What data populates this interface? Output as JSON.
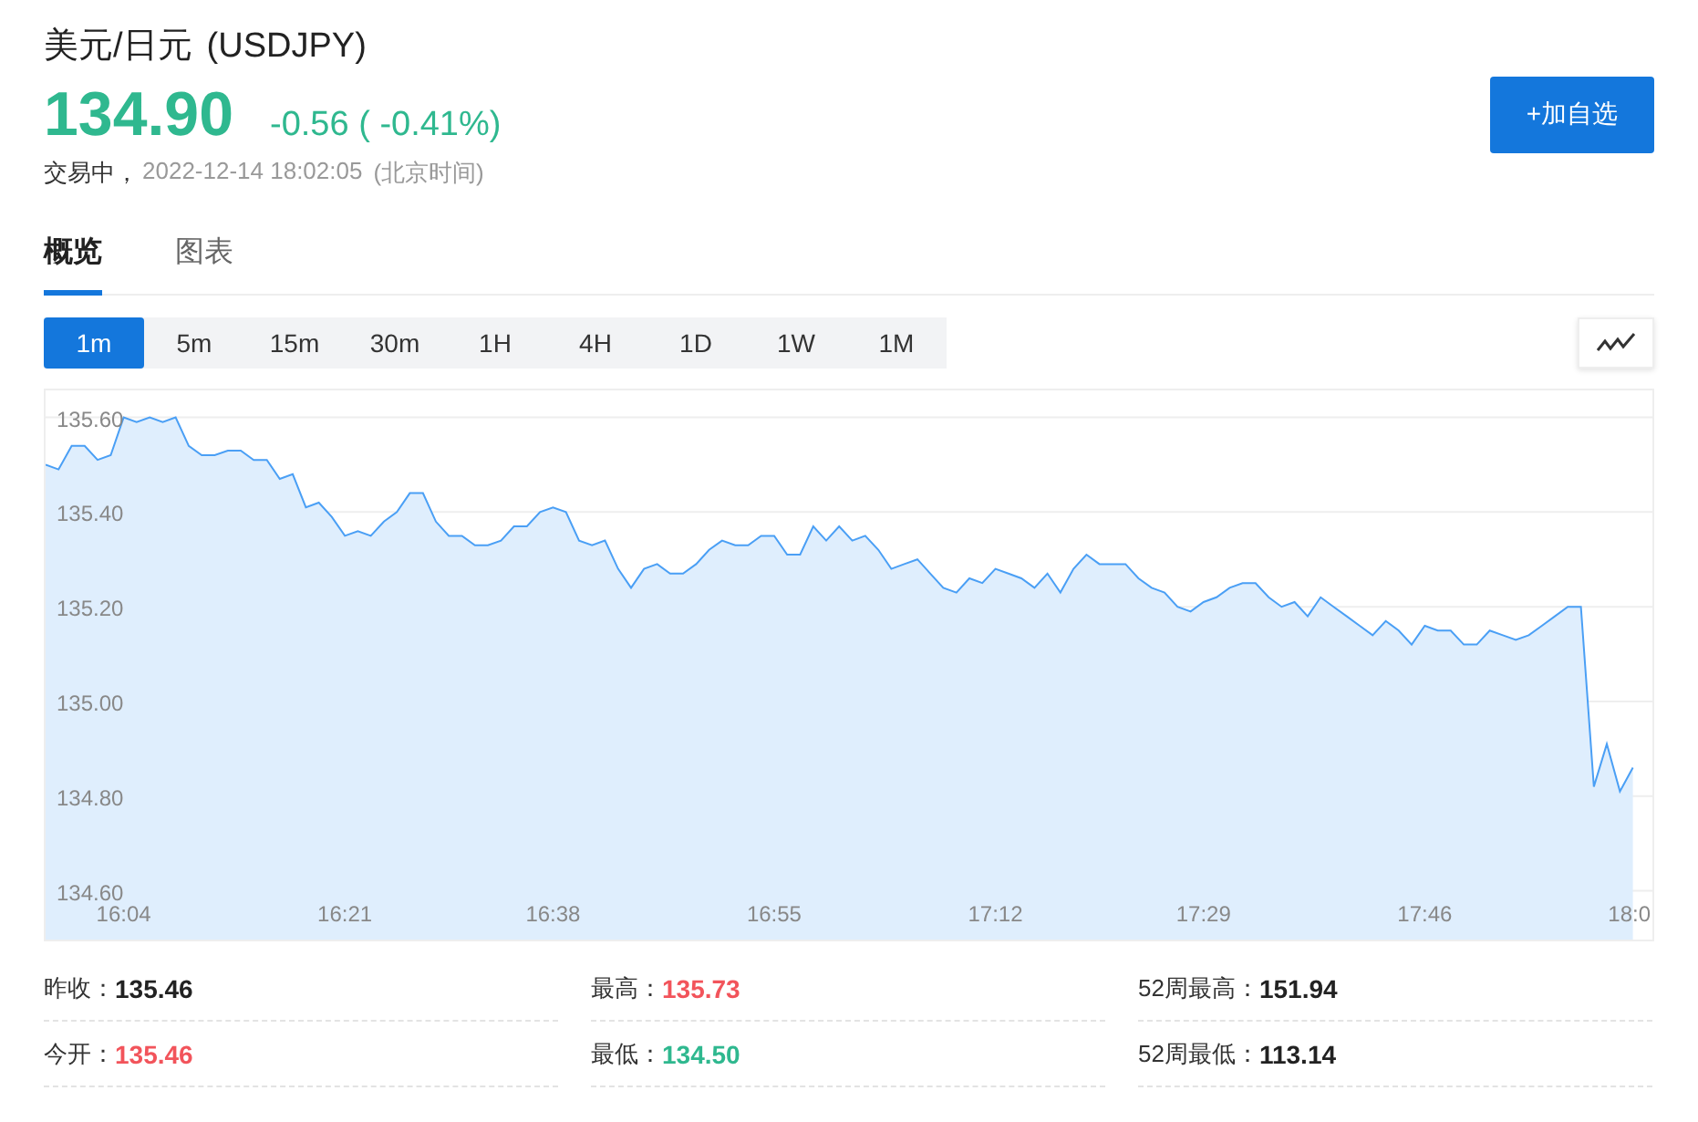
{
  "header": {
    "title": "美元/日元",
    "symbol": "(USDJPY)",
    "price": "134.90",
    "change": "-0.56 ( -0.41%)",
    "status": "交易中，",
    "timestamp": "2022-12-14 18:02:05",
    "timezone": "(北京时间)",
    "add_button": "+加自选"
  },
  "tabs": [
    {
      "label": "概览",
      "selected": true
    },
    {
      "label": "图表",
      "selected": false
    }
  ],
  "ranges": [
    {
      "label": "1m",
      "selected": true
    },
    {
      "label": "5m",
      "selected": false
    },
    {
      "label": "15m",
      "selected": false
    },
    {
      "label": "30m",
      "selected": false
    },
    {
      "label": "1H",
      "selected": false
    },
    {
      "label": "4H",
      "selected": false
    },
    {
      "label": "1D",
      "selected": false
    },
    {
      "label": "1W",
      "selected": false
    },
    {
      "label": "1M",
      "selected": false
    }
  ],
  "chart_data": {
    "type": "area",
    "grid": true,
    "ylim": [
      134.497,
      135.657
    ],
    "yticks": [
      {
        "value": 134.6,
        "label": "134.60"
      },
      {
        "value": 134.8,
        "label": "134.80"
      },
      {
        "value": 135.0,
        "label": "135.00"
      },
      {
        "value": 135.2,
        "label": "135.20"
      },
      {
        "value": 135.4,
        "label": "135.40"
      },
      {
        "value": 135.6,
        "label": "135.60"
      }
    ],
    "categories": [
      null,
      null,
      null,
      null,
      null,
      null,
      "16:04",
      null,
      null,
      null,
      null,
      null,
      null,
      null,
      null,
      null,
      null,
      null,
      null,
      null,
      null,
      null,
      null,
      "16:21",
      null,
      null,
      null,
      null,
      null,
      null,
      null,
      null,
      null,
      null,
      null,
      null,
      null,
      null,
      null,
      "16:38",
      null,
      null,
      null,
      null,
      null,
      null,
      null,
      null,
      null,
      null,
      null,
      null,
      null,
      null,
      null,
      null,
      "16:55",
      null,
      null,
      null,
      null,
      null,
      null,
      null,
      null,
      null,
      null,
      null,
      null,
      null,
      null,
      null,
      null,
      "17:12",
      null,
      null,
      null,
      null,
      null,
      null,
      null,
      null,
      null,
      null,
      null,
      null,
      null,
      null,
      null,
      "17:29",
      null,
      null,
      null,
      null,
      null,
      null,
      null,
      null,
      null,
      null,
      null,
      null,
      null,
      null,
      null,
      null,
      "17:46",
      null,
      null,
      null,
      null,
      null,
      null,
      null,
      null,
      null,
      null,
      null,
      null,
      null,
      null,
      null,
      "18:0"
    ],
    "series": [
      {
        "color": "#4a9ff5",
        "values": [
          135.5,
          135.49,
          135.54,
          135.54,
          135.51,
          135.52,
          135.6,
          135.59,
          135.6,
          135.59,
          135.6,
          135.54,
          135.52,
          135.52,
          135.53,
          135.53,
          135.51,
          135.51,
          135.47,
          135.48,
          135.41,
          135.42,
          135.39,
          135.35,
          135.36,
          135.35,
          135.38,
          135.4,
          135.44,
          135.44,
          135.38,
          135.35,
          135.35,
          135.33,
          135.33,
          135.34,
          135.37,
          135.37,
          135.4,
          135.41,
          135.4,
          135.34,
          135.33,
          135.34,
          135.28,
          135.24,
          135.28,
          135.29,
          135.27,
          135.27,
          135.29,
          135.32,
          135.34,
          135.33,
          135.33,
          135.35,
          135.35,
          135.31,
          135.31,
          135.37,
          135.34,
          135.37,
          135.34,
          135.35,
          135.32,
          135.28,
          135.29,
          135.3,
          135.27,
          135.24,
          135.23,
          135.26,
          135.25,
          135.28,
          135.27,
          135.26,
          135.24,
          135.27,
          135.23,
          135.28,
          135.31,
          135.29,
          135.29,
          135.29,
          135.26,
          135.24,
          135.23,
          135.2,
          135.19,
          135.21,
          135.22,
          135.24,
          135.25,
          135.25,
          135.22,
          135.2,
          135.21,
          135.18,
          135.22,
          135.2,
          135.18,
          135.16,
          135.14,
          135.17,
          135.15,
          135.12,
          135.16,
          135.15,
          135.15,
          135.12,
          135.12,
          135.15,
          135.14,
          135.13,
          135.14,
          135.16,
          135.18,
          135.2,
          135.2,
          134.82,
          134.91,
          134.81,
          134.86
        ]
      }
    ]
  },
  "stats": [
    {
      "label": "昨收：",
      "value": "135.46",
      "color": "#222222"
    },
    {
      "label": "最高：",
      "value": "135.73",
      "color": "#f2545b"
    },
    {
      "label": "52周最高：",
      "value": "151.94",
      "color": "#222222"
    },
    {
      "label": "今开：",
      "value": "135.46",
      "color": "#f2545b"
    },
    {
      "label": "最低：",
      "value": "134.50",
      "color": "#2fb88f"
    },
    {
      "label": "52周最低：",
      "value": "113.14",
      "color": "#222222"
    }
  ]
}
